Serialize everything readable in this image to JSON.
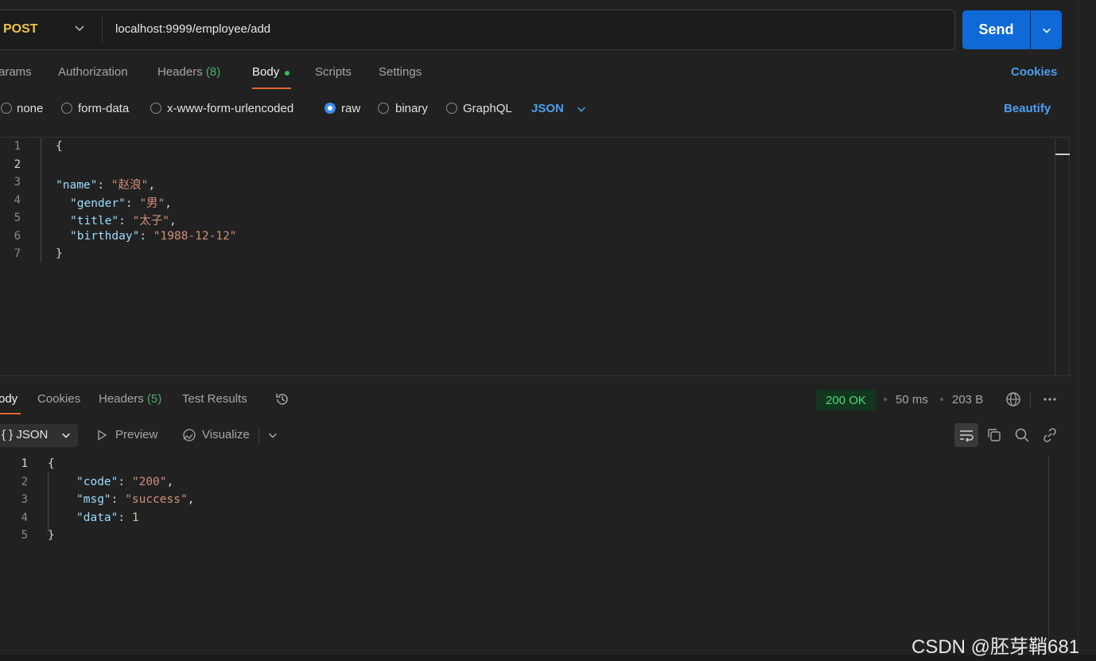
{
  "request": {
    "method": "POST",
    "url": "localhost:9999/employee/add",
    "send_label": "Send",
    "tabs": [
      {
        "label": "arams"
      },
      {
        "label": "Authorization"
      },
      {
        "label": "Headers",
        "count": "(8)"
      },
      {
        "label": "Body"
      },
      {
        "label": "Scripts"
      },
      {
        "label": "Settings"
      }
    ],
    "cookies_label": "Cookies",
    "body_types": [
      "none",
      "form-data",
      "x-www-form-urlencoded",
      "raw",
      "binary",
      "GraphQL"
    ],
    "selected_body_type": "raw",
    "format": "JSON",
    "beautify_label": "Beautify",
    "line_numbers": [
      "1",
      "2",
      "3",
      "4",
      "5",
      "6",
      "7"
    ],
    "body": {
      "open": "{",
      "close": "}",
      "fields": [
        {
          "key": "\"name\"",
          "value": "\"赵浪\""
        },
        {
          "key": "\"gender\"",
          "value": "\"男\""
        },
        {
          "key": "\"title\"",
          "value": "\"太子\""
        },
        {
          "key": "\"birthday\"",
          "value": "\"1988-12-12\""
        }
      ]
    }
  },
  "response": {
    "tabs": [
      {
        "label": "ody"
      },
      {
        "label": "Cookies"
      },
      {
        "label": "Headers",
        "count": "(5)"
      },
      {
        "label": "Test Results"
      }
    ],
    "status": "200 OK",
    "time": "50 ms",
    "size": "203 B",
    "format": "JSON",
    "preview_label": "Preview",
    "visualize_label": "Visualize",
    "line_numbers": [
      "1",
      "2",
      "3",
      "4",
      "5"
    ],
    "body": {
      "open": "{",
      "close": "}",
      "fields": [
        {
          "key": "\"code\"",
          "value": "\"200\""
        },
        {
          "key": "\"msg\"",
          "value": "\"success\""
        },
        {
          "key": "\"data\"",
          "value": "1"
        }
      ]
    }
  },
  "watermark": "CSDN @胚芽鞘681",
  "colors": {
    "accent": "#0f6ad7",
    "method": "#f0c24a",
    "link": "#4d9ef0",
    "status_ok": "#4cd67a",
    "tab_underline": "#e0662f"
  }
}
